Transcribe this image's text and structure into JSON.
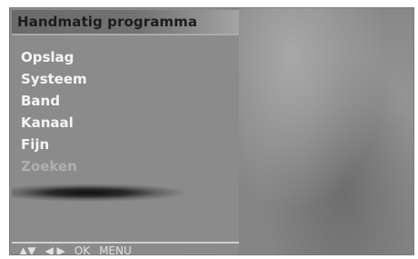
{
  "menu": {
    "title": "Handmatig programma",
    "items": [
      {
        "label": "Opslag",
        "state": "normal"
      },
      {
        "label": "Systeem",
        "state": "normal"
      },
      {
        "label": "Band",
        "state": "normal"
      },
      {
        "label": "Kanaal",
        "state": "normal"
      },
      {
        "label": "Fijn",
        "state": "normal"
      },
      {
        "label": "Zoeken",
        "state": "dimmed"
      }
    ]
  },
  "footer": {
    "up_down_icon": "▲▼",
    "left_right_icon": "◀ ▶",
    "ok_label": "OK",
    "menu_label": "MENU"
  }
}
